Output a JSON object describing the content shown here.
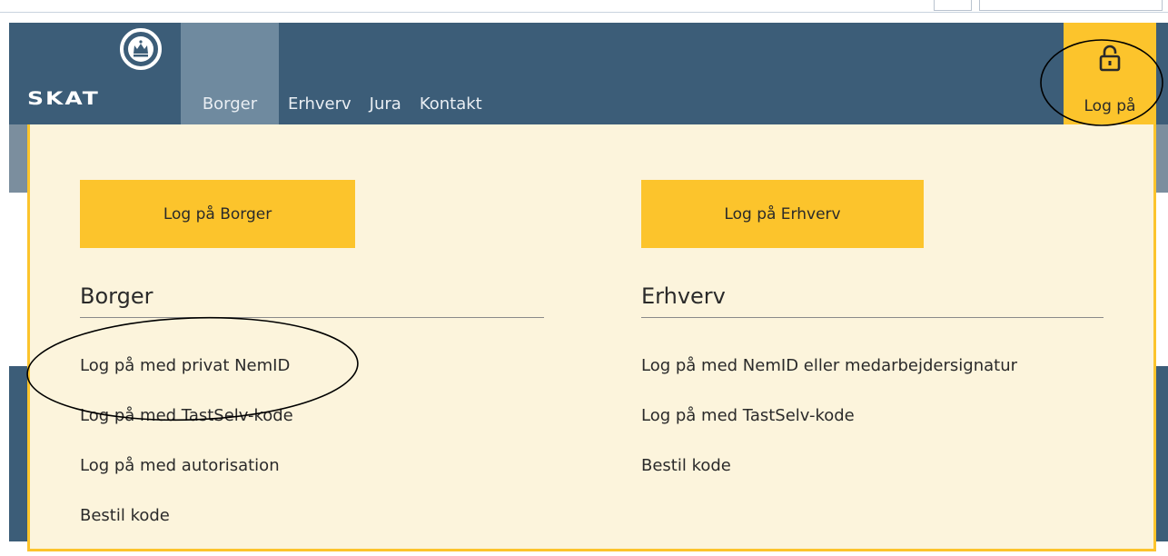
{
  "header": {
    "logo_text": "SKAT",
    "nav": [
      "Borger",
      "Erhverv",
      "Jura",
      "Kontakt"
    ],
    "login_label": "Log på"
  },
  "dropdown": {
    "borger": {
      "button": "Log på Borger",
      "heading": "Borger",
      "links": [
        "Log på med privat NemID",
        "Log på med TastSelv-kode",
        "Log på med autorisation",
        "Bestil kode"
      ]
    },
    "erhverv": {
      "button": "Log på Erhverv",
      "heading": "Erhverv",
      "links": [
        "Log på med NemID eller medarbejdersignatur",
        "Log på med TastSelv-kode",
        "Bestil kode"
      ]
    }
  },
  "icons": {
    "crown": "crown-logo-icon",
    "lock": "lock-icon"
  },
  "colors": {
    "header_bg": "#3c5d78",
    "active_nav_bg": "#6f8a9f",
    "accent_yellow": "#fcc42c",
    "dropdown_bg": "#fcf4dc"
  }
}
